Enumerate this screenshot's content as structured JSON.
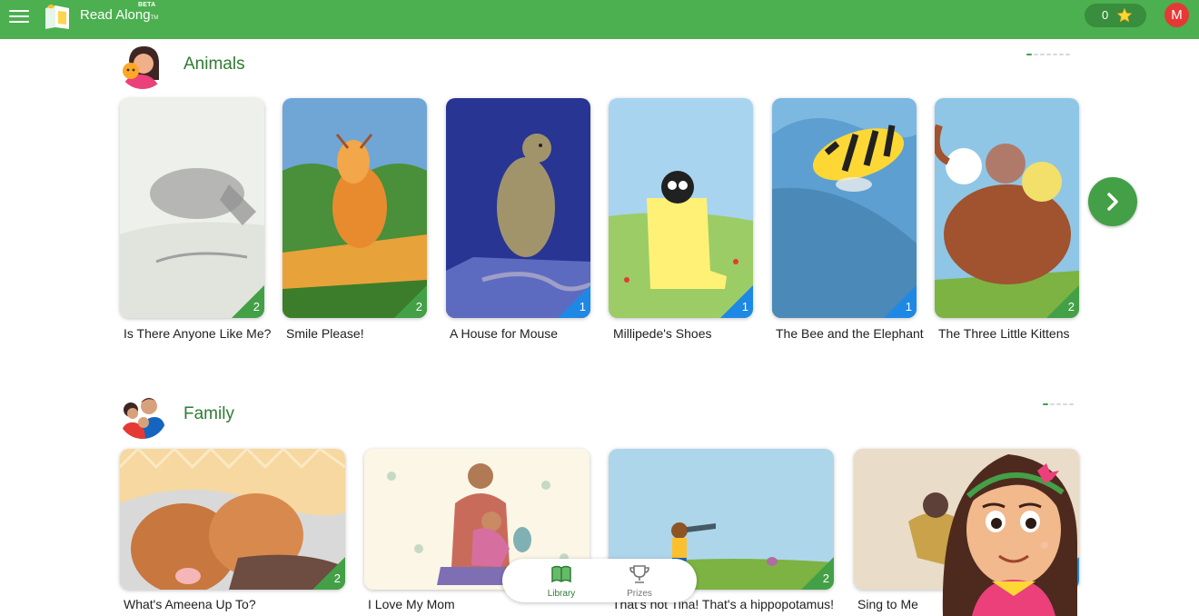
{
  "header": {
    "app_name": "Read Along",
    "trademark": "TM",
    "badge": "BETA",
    "points": "0",
    "user_initial": "M"
  },
  "colors": {
    "brand_green": "#4caf50",
    "title_green": "#2e7d32",
    "level_green": "#43a047",
    "level_blue": "#1e88e5",
    "avatar_red": "#e53935"
  },
  "sections": [
    {
      "title": "Animals",
      "books": [
        {
          "title": "Is There Anyone Like Me?",
          "level": "2"
        },
        {
          "title": "Smile Please!",
          "level": "2"
        },
        {
          "title": "A House for Mouse",
          "level": "1"
        },
        {
          "title": "Millipede's Shoes",
          "level": "1"
        },
        {
          "title": "The Bee and the Elephant",
          "level": "1"
        },
        {
          "title": "The Three Little Kittens",
          "level": "2"
        }
      ]
    },
    {
      "title": "Family",
      "books": [
        {
          "title": "What's Ameena Up To?",
          "level": "2"
        },
        {
          "title": "I Love My Mom",
          "level": ""
        },
        {
          "title": "That's not Tina! That's a hippopotamus!",
          "level": "2"
        },
        {
          "title": "Sing to Me",
          "level": "1"
        }
      ]
    }
  ],
  "bottom_nav": {
    "library": "Library",
    "prizes": "Prizes"
  },
  "icons": [
    "menu-icon",
    "read-along-logo-icon",
    "star-icon",
    "chevron-right-icon",
    "library-book-icon",
    "trophy-icon"
  ]
}
